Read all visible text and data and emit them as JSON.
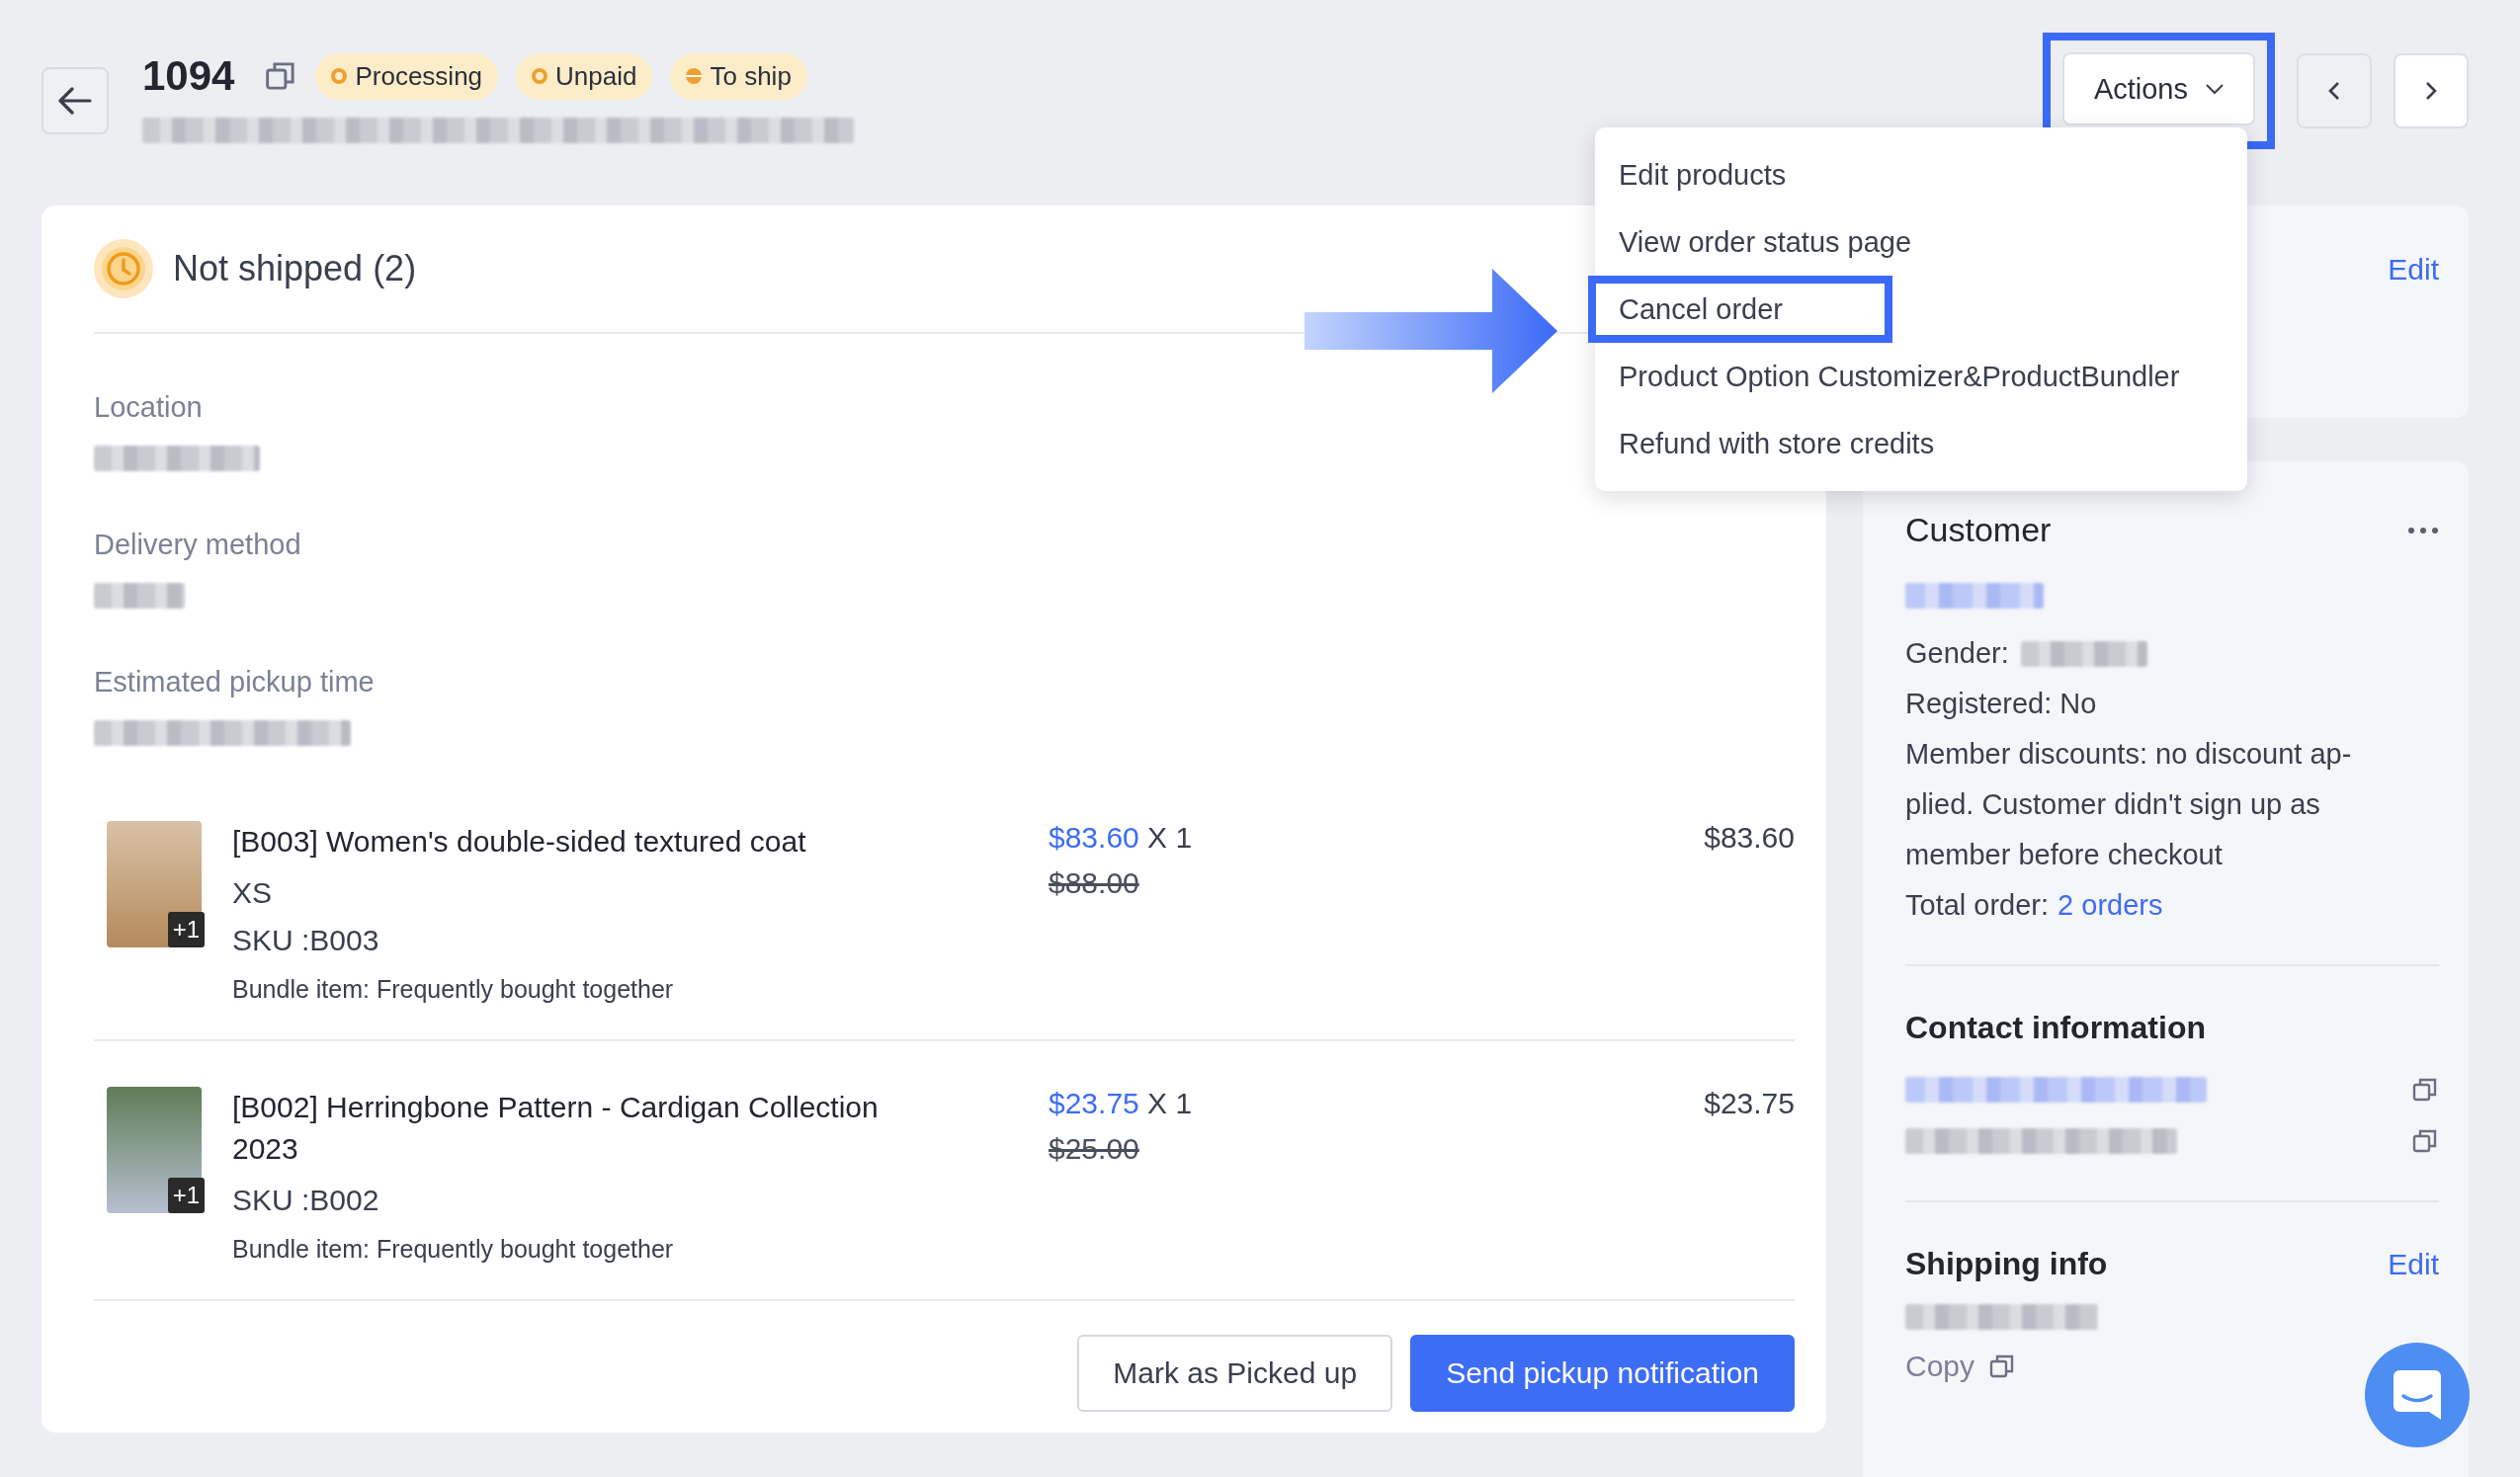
{
  "header": {
    "order_number": "1094",
    "badges": [
      {
        "label": "Processing",
        "kind": "ring"
      },
      {
        "label": "Unpaid",
        "kind": "ring"
      },
      {
        "label": "To ship",
        "kind": "half"
      }
    ]
  },
  "actions_button": {
    "label": "Actions",
    "expanded": true,
    "highlighted": true
  },
  "actions_menu": {
    "items": [
      {
        "label": "Edit products",
        "highlighted": false
      },
      {
        "label": "View order status page",
        "highlighted": false
      },
      {
        "label": "Cancel order",
        "highlighted": true
      },
      {
        "label": "Product Option Customizer&ProductBundler",
        "highlighted": false
      },
      {
        "label": "Refund with store credits",
        "highlighted": false
      }
    ]
  },
  "fulfillment": {
    "title": "Not shipped (2)",
    "fields": [
      {
        "label": "Location"
      },
      {
        "label": "Delivery method"
      },
      {
        "label": "Estimated pickup time"
      }
    ],
    "items": [
      {
        "title": "[B003] Women's double-sided textured coat",
        "variant": "XS",
        "sku": "SKU :B003",
        "bundle": "Bundle item: Frequently bought together",
        "price": "$83.60",
        "quantity": "X 1",
        "original_price": "$88.00",
        "total": "$83.60",
        "image_badge": "+1"
      },
      {
        "title": "[B002] Herringbone Pattern - Cardigan Collection 2023",
        "sku": "SKU :B002",
        "bundle": "Bundle item: Frequently bought together",
        "price": "$23.75",
        "quantity": "X 1",
        "original_price": "$25.00",
        "total": "$23.75",
        "image_badge": "+1"
      }
    ],
    "buttons": [
      {
        "label": "Mark as Picked up",
        "kind": "secondary"
      },
      {
        "label": "Send pickup notification",
        "kind": "primary"
      }
    ]
  },
  "notes_card": {
    "action": "Edit"
  },
  "customer": {
    "title": "Customer",
    "gender_label": "Gender:",
    "registered": "Registered: No",
    "member_discounts": "Member discounts: no discount ap-plied. Customer didn't sign up as member before checkout",
    "total_label": "Total order:",
    "total_link": "2 orders"
  },
  "contact": {
    "title": "Contact information"
  },
  "shipping": {
    "title": "Shipping info",
    "action": "Edit",
    "copy": "Copy"
  }
}
